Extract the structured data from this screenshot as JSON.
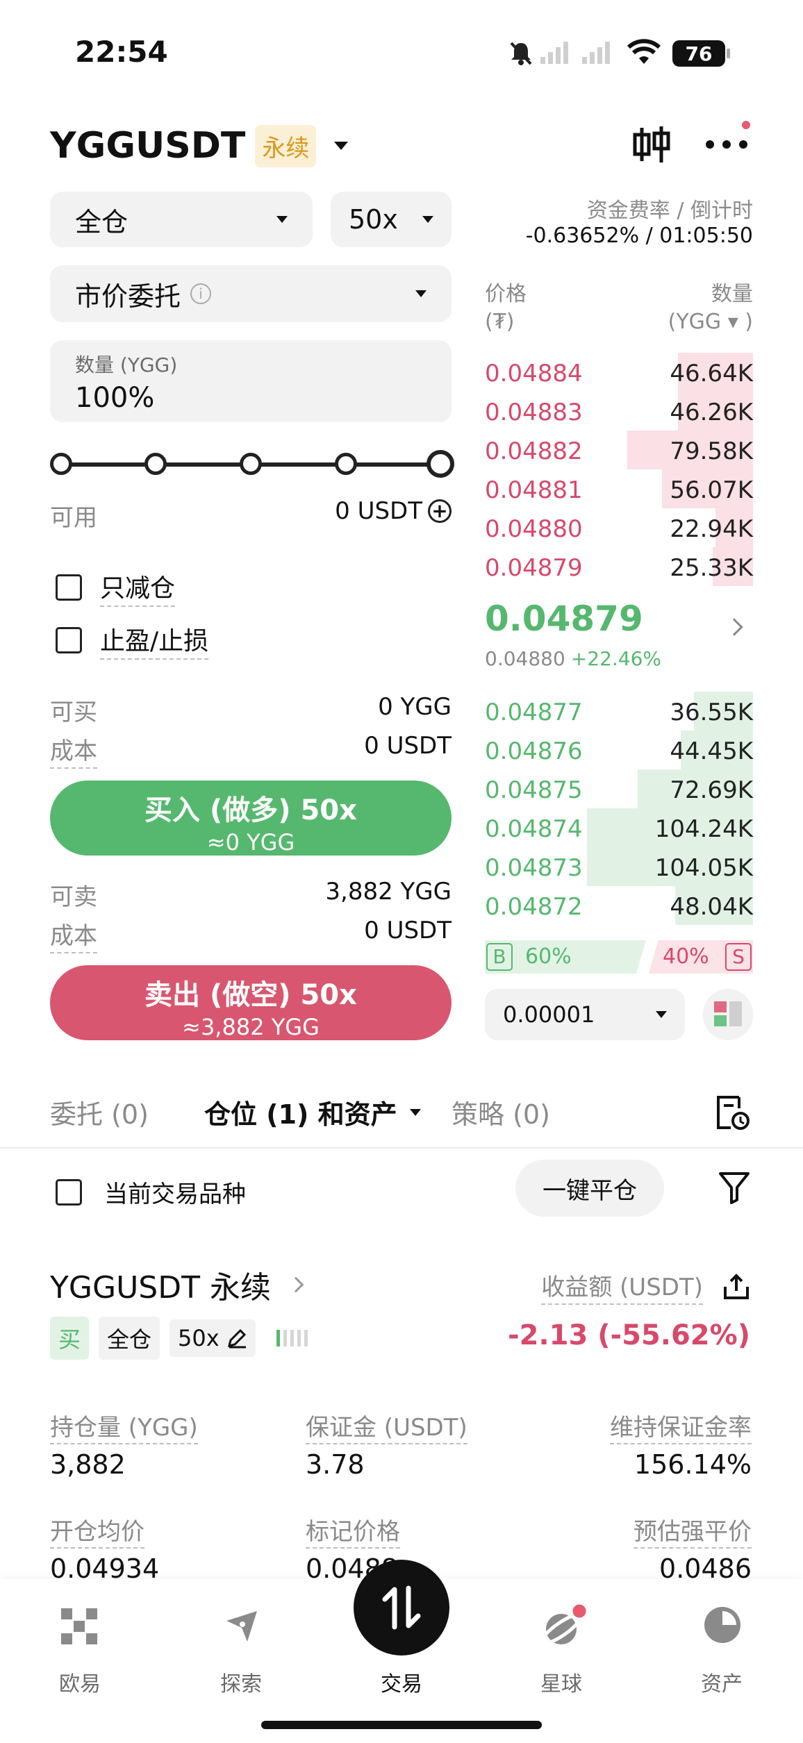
{
  "status_bar": {
    "time": "22:54",
    "battery": "76"
  },
  "header": {
    "symbol": "YGGUSDT",
    "tag": "永续"
  },
  "order_form": {
    "margin_mode": "全仓",
    "leverage": "50x",
    "order_type": "市价委托",
    "qty_label": "数量 (YGG)",
    "qty_value": "100%",
    "slider_percent": 100,
    "available_label": "可用",
    "available_value": "0 USDT",
    "reduce_only": "只减仓",
    "tp_sl": "止盈/止损",
    "can_buy_label": "可买",
    "can_buy_value": "0 YGG",
    "cost_label": "成本",
    "cost_buy_value": "0 USDT",
    "buy_button": "买入 (做多) 50x",
    "buy_sub": "≈0 YGG",
    "can_sell_label": "可卖",
    "can_sell_value": "3,882 YGG",
    "cost_sell_value": "0 USDT",
    "sell_button": "卖出 (做空) 50x",
    "sell_sub": "≈3,882 YGG"
  },
  "funding": {
    "label": "资金费率 / 倒计时",
    "value": "-0.63652% / 01:05:50"
  },
  "orderbook": {
    "price_header": "价格",
    "price_unit": "(₮)",
    "qty_header": "数量",
    "qty_unit": "(YGG ▾ )",
    "asks": [
      {
        "price": "0.04884",
        "qty": "46.64K",
        "depth": 0.28
      },
      {
        "price": "0.04883",
        "qty": "46.26K",
        "depth": 0.28
      },
      {
        "price": "0.04882",
        "qty": "79.58K",
        "depth": 0.47
      },
      {
        "price": "0.04881",
        "qty": "56.07K",
        "depth": 0.34
      },
      {
        "price": "0.04880",
        "qty": "22.94K",
        "depth": 0.14
      },
      {
        "price": "0.04879",
        "qty": "25.33K",
        "depth": 0.15
      }
    ],
    "last_price": "0.04879",
    "mark_price": "0.04880",
    "change": "+22.46%",
    "bids": [
      {
        "price": "0.04877",
        "qty": "36.55K",
        "depth": 0.22
      },
      {
        "price": "0.04876",
        "qty": "44.45K",
        "depth": 0.27
      },
      {
        "price": "0.04875",
        "qty": "72.69K",
        "depth": 0.43
      },
      {
        "price": "0.04874",
        "qty": "104.24K",
        "depth": 0.62
      },
      {
        "price": "0.04873",
        "qty": "104.05K",
        "depth": 0.62
      },
      {
        "price": "0.04872",
        "qty": "48.04K",
        "depth": 0.29
      }
    ],
    "buy_ratio_label": "B",
    "buy_ratio": "60%",
    "sell_ratio": "40%",
    "sell_ratio_label": "S",
    "precision": "0.00001"
  },
  "tabs": {
    "orders": "委托 (0)",
    "positions": "仓位 (1) 和资产",
    "strategy": "策略 (0)"
  },
  "filter_bar": {
    "current_symbol": "当前交易品种",
    "close_all": "一键平仓"
  },
  "position": {
    "title": "YGGUSDT 永续",
    "pnl_label": "收益额 (USDT)",
    "side": "买",
    "mode": "全仓",
    "leverage": "50x",
    "pnl_value": "-2.13 (-55.62%)",
    "size_label": "持仓量 (YGG)",
    "size_value": "3,882",
    "margin_label": "保证金 (USDT)",
    "margin_value": "3.78",
    "mmr_label": "维持保证金率",
    "mmr_value": "156.14%",
    "entry_label": "开仓均价",
    "entry_value": "0.04934",
    "mark_label": "标记价格",
    "mark_value": "0.0488",
    "liq_label": "预估强平价",
    "liq_value": "0.0486"
  },
  "bottom_nav": [
    {
      "label": "欧易",
      "icon": "okx-icon"
    },
    {
      "label": "探索",
      "icon": "compass-icon"
    },
    {
      "label": "交易",
      "icon": "trade-icon"
    },
    {
      "label": "星球",
      "icon": "planet-icon"
    },
    {
      "label": "资产",
      "icon": "pie-icon"
    }
  ],
  "colors": {
    "buy": "#55b86e",
    "sell": "#d7496a",
    "tag": "#d89a1c"
  }
}
